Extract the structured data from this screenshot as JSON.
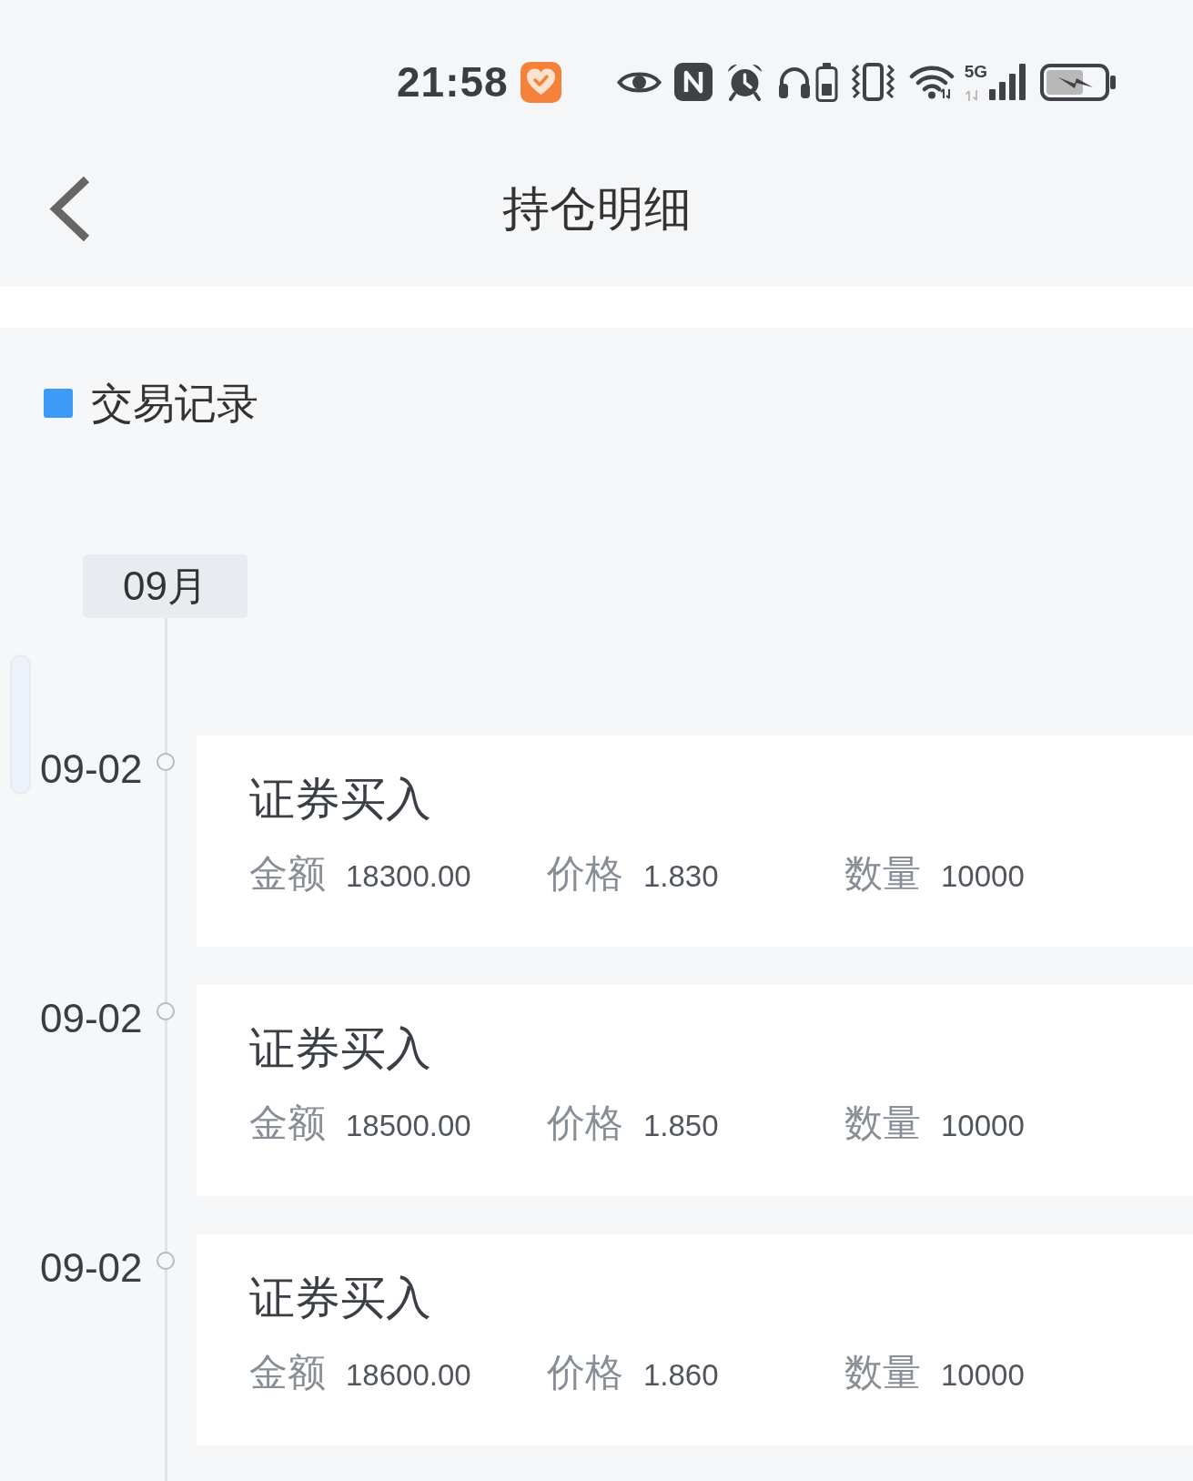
{
  "status_bar": {
    "time": "21:58",
    "network": "5G"
  },
  "header": {
    "title": "持仓明细"
  },
  "section": {
    "title": "交易记录"
  },
  "timeline": {
    "month": "09月",
    "records": [
      {
        "date": "09-02",
        "title": "证券买入",
        "fields": [
          {
            "label": "金额",
            "value": "18300.00"
          },
          {
            "label": "价格",
            "value": "1.830"
          },
          {
            "label": "数量",
            "value": "10000"
          }
        ]
      },
      {
        "date": "09-02",
        "title": "证券买入",
        "fields": [
          {
            "label": "金额",
            "value": "18500.00"
          },
          {
            "label": "价格",
            "value": "1.850"
          },
          {
            "label": "数量",
            "value": "10000"
          }
        ]
      },
      {
        "date": "09-02",
        "title": "证券买入",
        "fields": [
          {
            "label": "金额",
            "value": "18600.00"
          },
          {
            "label": "价格",
            "value": "1.860"
          },
          {
            "label": "数量",
            "value": "10000"
          }
        ]
      }
    ]
  }
}
